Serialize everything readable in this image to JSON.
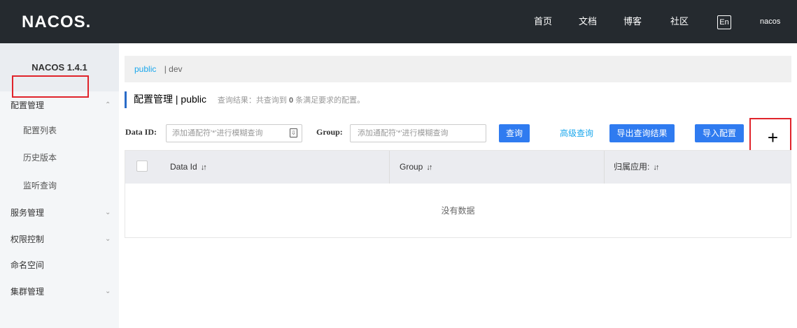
{
  "header": {
    "logo": "NACOS.",
    "nav": [
      "首页",
      "文档",
      "博客",
      "社区"
    ],
    "lang": "En",
    "user": "nacos"
  },
  "sidebar": {
    "version": "NACOS 1.4.1",
    "items": [
      {
        "label": "配置管理",
        "chevron": "^"
      },
      {
        "label": "配置列表"
      },
      {
        "label": "历史版本"
      },
      {
        "label": "监听查询"
      },
      {
        "label": "服务管理",
        "chevron": "v"
      },
      {
        "label": "权限控制",
        "chevron": "v"
      },
      {
        "label": "命名空间"
      },
      {
        "label": "集群管理",
        "chevron": "v"
      }
    ]
  },
  "breadcrumb": {
    "ns": "public",
    "sep": "| dev"
  },
  "title": {
    "main": "配置管理 | public",
    "query_prefix": "查询结果：共查询到",
    "query_count": "0",
    "query_suffix": "条满足要求的配置。"
  },
  "search": {
    "dataid_label": "Data ID:",
    "dataid_placeholder": "添加通配符'*'进行模糊查询",
    "group_label": "Group:",
    "group_placeholder": "添加通配符'*'进行模糊查询",
    "query_btn": "查询",
    "advanced_link": "高级查询",
    "export_btn": "导出查询结果",
    "import_btn": "导入配置",
    "add_btn": "+"
  },
  "table": {
    "headers": [
      "Data Id",
      "Group",
      "归属应用:"
    ],
    "sort_glyph": "↓↑",
    "empty": "没有数据"
  },
  "colors": {
    "header_bg": "#252a2f",
    "primary": "#2f7bf0",
    "link": "#1aa7ec",
    "highlight": "#e0242b"
  }
}
